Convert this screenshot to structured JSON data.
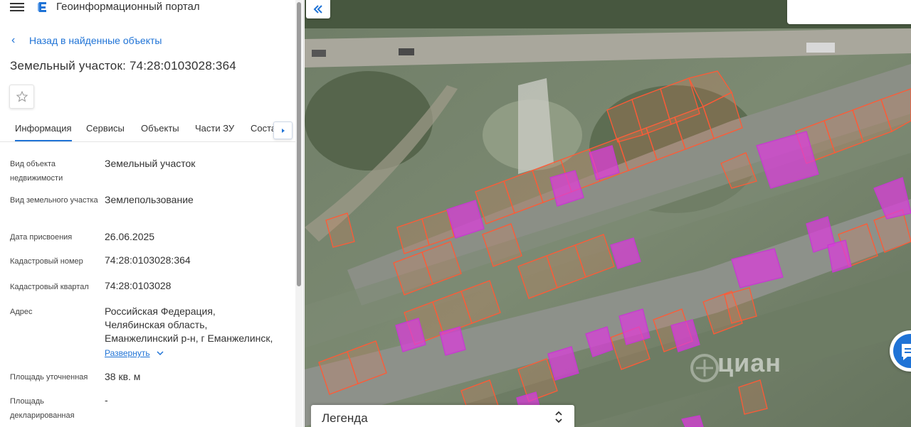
{
  "header": {
    "app_title": "Геоинформационный портал"
  },
  "back_link": {
    "label": "Назад в найденные объекты"
  },
  "page_title": "Земельный участок: 74:28:0103028:364",
  "tabs": [
    {
      "label": "Информация",
      "active": true
    },
    {
      "label": "Сервисы"
    },
    {
      "label": "Объекты"
    },
    {
      "label": "Части ЗУ"
    },
    {
      "label": "Соста"
    }
  ],
  "info": {
    "object_type_label": "Вид объекта недвижимости",
    "object_type_value": "Земельный участок",
    "land_type_label": "Вид земельного участка",
    "land_type_value": "Землепользование",
    "date_label": "Дата присвоения",
    "date_value": "26.06.2025",
    "cad_number_label": "Кадастровый номер",
    "cad_number_value": "74:28:0103028:364",
    "cad_quarter_label": "Кадастровый квартал",
    "cad_quarter_value": "74:28:0103028",
    "address_label": "Адрес",
    "address_line1": "Российская Федерация,",
    "address_line2": "Челябинская область,",
    "address_line3": "Еманжелинский р-н, г Еманжелинск,",
    "expand_label": "Развернуть",
    "area_label": "Площадь уточненная",
    "area_value": "38 кв. м",
    "declared_area_label": "Площадь декларированная",
    "declared_area_value": "-"
  },
  "map": {
    "legend_label": "Легенда",
    "watermark_text": "циан"
  },
  "colors": {
    "accent": "#1f73d6",
    "parcel_outline": "#ff5a36",
    "parcel_selected": "#d43fd1"
  }
}
